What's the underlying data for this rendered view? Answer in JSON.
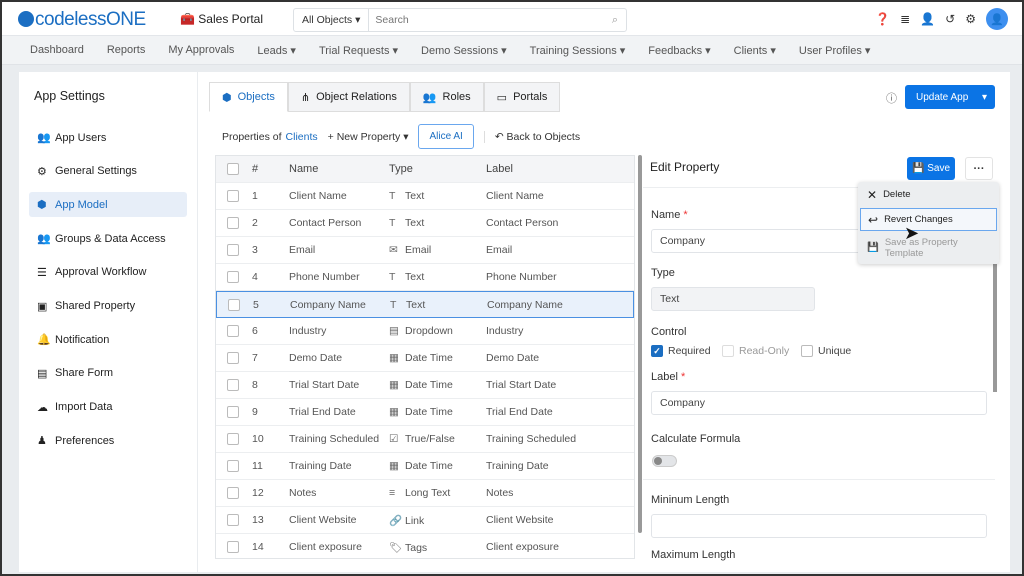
{
  "header": {
    "logo": "codelessONE",
    "portal": "Sales Portal",
    "search_scope": "All Objects",
    "search_placeholder": "Search"
  },
  "nav": [
    "Dashboard",
    "Reports",
    "My Approvals",
    "Leads ▾",
    "Trial Requests ▾",
    "Demo Sessions ▾",
    "Training Sessions ▾",
    "Feedbacks ▾",
    "Clients ▾",
    "User Profiles ▾"
  ],
  "sidebar": {
    "title": "App Settings",
    "items": [
      {
        "label": "App Users",
        "icon": "👥"
      },
      {
        "label": "General Settings",
        "icon": "⚙"
      },
      {
        "label": "App Model",
        "icon": "⬢"
      },
      {
        "label": "Groups & Data Access",
        "icon": "👥"
      },
      {
        "label": "Approval Workflow",
        "icon": "☰"
      },
      {
        "label": "Shared Property",
        "icon": "▣"
      },
      {
        "label": "Notification",
        "icon": "🔔"
      },
      {
        "label": "Share Form",
        "icon": "▤"
      },
      {
        "label": "Import Data",
        "icon": "☁"
      },
      {
        "label": "Preferences",
        "icon": "♟"
      }
    ],
    "active": 2
  },
  "tabs": [
    {
      "label": "Objects",
      "icon": "⬢"
    },
    {
      "label": "Object Relations",
      "icon": "⋔"
    },
    {
      "label": "Roles",
      "icon": "👥"
    },
    {
      "label": "Portals",
      "icon": "▭"
    }
  ],
  "toolbar": {
    "update_app": "Update App",
    "properties_of": "Properties of",
    "object": "Clients",
    "new_property": "+ New Property ▾",
    "alice": "Alice AI",
    "back": "↶ Back to Objects"
  },
  "table": {
    "headers": [
      "#",
      "Name",
      "Type",
      "Label"
    ],
    "rows": [
      [
        "1",
        "Client Name",
        "T",
        "Text",
        "Client Name"
      ],
      [
        "2",
        "Contact Person",
        "T",
        "Text",
        "Contact Person"
      ],
      [
        "3",
        "Email",
        "✉",
        "Email",
        "Email"
      ],
      [
        "4",
        "Phone Number",
        "T",
        "Text",
        "Phone Number"
      ],
      [
        "5",
        "Company Name",
        "T",
        "Text",
        "Company Name"
      ],
      [
        "6",
        "Industry",
        "▤",
        "Dropdown",
        "Industry"
      ],
      [
        "7",
        "Demo Date",
        "▦",
        "Date Time",
        "Demo Date"
      ],
      [
        "8",
        "Trial Start Date",
        "▦",
        "Date Time",
        "Trial Start Date"
      ],
      [
        "9",
        "Trial End Date",
        "▦",
        "Date Time",
        "Trial End Date"
      ],
      [
        "10",
        "Training Scheduled",
        "☑",
        "True/False",
        "Training Scheduled"
      ],
      [
        "11",
        "Training Date",
        "▦",
        "Date Time",
        "Training Date"
      ],
      [
        "12",
        "Notes",
        "≡",
        "Long Text",
        "Notes"
      ],
      [
        "13",
        "Client Website",
        "🔗",
        "Link",
        "Client Website"
      ],
      [
        "14",
        "Client exposure",
        "🏷",
        "Tags",
        "Client exposure"
      ]
    ],
    "selected": 4
  },
  "edit": {
    "title": "Edit Property",
    "save": "Save",
    "name_label": "Name",
    "name_value": "Company",
    "type_label": "Type",
    "type_value": "Text",
    "control_label": "Control",
    "required": "Required",
    "readonly": "Read-Only",
    "unique": "Unique",
    "label_label": "Label",
    "label_value": "Company",
    "formula_label": "Calculate Formula",
    "min_label": "Mininum Length",
    "max_label": "Maximum Length"
  },
  "menu": {
    "delete": "Delete",
    "revert": "Revert Changes",
    "template": "Save as Property Template"
  }
}
